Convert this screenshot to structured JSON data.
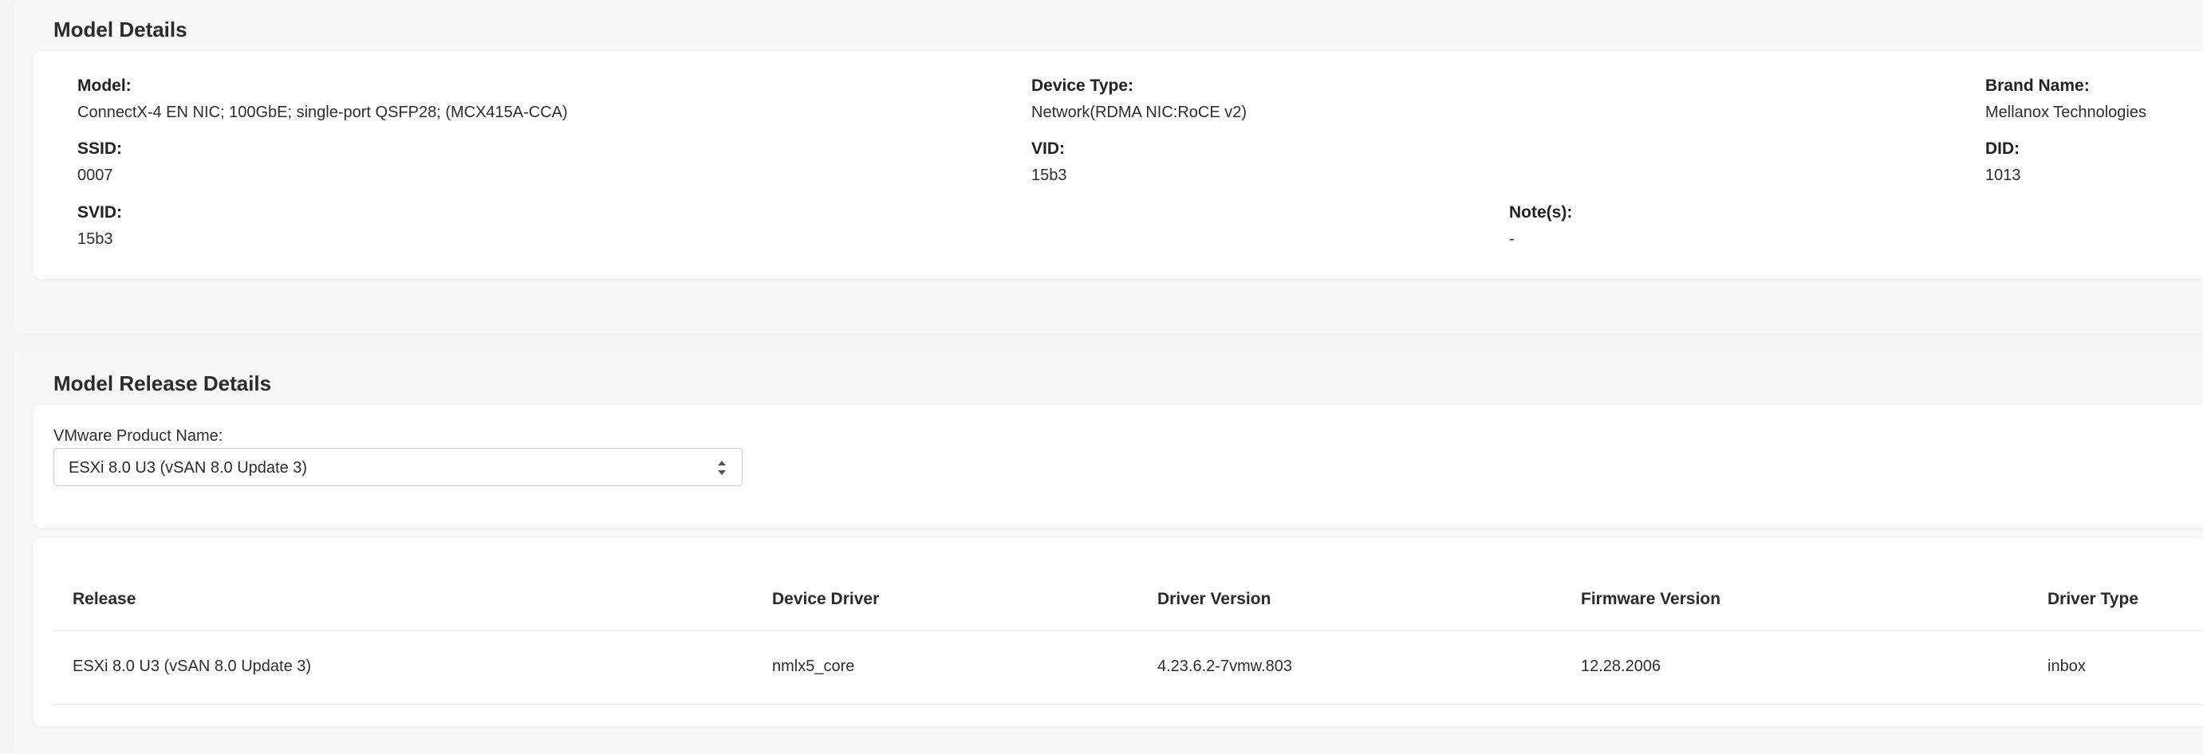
{
  "model_details": {
    "title": "Model Details",
    "fields": {
      "model": {
        "label": "Model:",
        "value": "ConnectX-4 EN NIC; 100GbE; single-port QSFP28; (MCX415A-CCA)"
      },
      "device_type": {
        "label": "Device Type:",
        "value": "Network(RDMA NIC:RoCE v2)"
      },
      "brand_name": {
        "label": "Brand Name:",
        "value": "Mellanox Technologies"
      },
      "ssid": {
        "label": "SSID:",
        "value": "0007"
      },
      "vid": {
        "label": "VID:",
        "value": "15b3"
      },
      "did": {
        "label": "DID:",
        "value": "1013"
      },
      "svid": {
        "label": "SVID:",
        "value": "15b3"
      },
      "notes": {
        "label": "Note(s):",
        "value": "-"
      }
    }
  },
  "model_release_details": {
    "title": "Model Release Details",
    "product_select": {
      "label": "VMware Product Name:",
      "selected": "ESXi 8.0 U3 (vSAN 8.0 Update 3)"
    },
    "table": {
      "headers": {
        "release": "Release",
        "device_driver": "Device Driver",
        "driver_version": "Driver Version",
        "firmware_version": "Firmware Version",
        "driver_type": "Driver Type"
      },
      "rows": [
        {
          "release": "ESXi 8.0 U3 (vSAN  8.0 Update 3)",
          "device_driver": "nmlx5_core",
          "driver_version": "4.23.6.2-7vmw.803",
          "firmware_version": "12.28.2006",
          "driver_type": "inbox"
        }
      ]
    }
  },
  "colors": {
    "page_background": "#f3f4f6",
    "card_background": "#ffffff",
    "text": "#2a2a2a"
  }
}
